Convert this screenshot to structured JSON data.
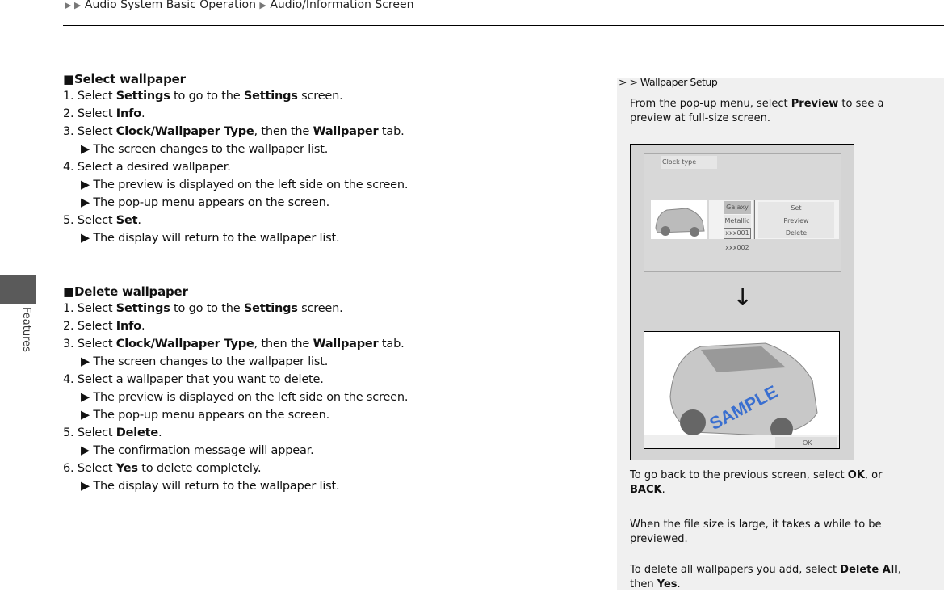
{
  "breadcrumb": {
    "items": [
      "Audio System Basic Operation",
      "Audio/Information Screen"
    ]
  },
  "side_tab": {
    "label": "Features"
  },
  "main": {
    "sections": [
      {
        "heading": "Select wallpaper",
        "lines": [
          [
            {
              "t": "1. Select "
            },
            {
              "t": "Settings",
              "b": true
            },
            {
              "t": " to go to the "
            },
            {
              "t": "Settings",
              "b": true
            },
            {
              "t": " screen."
            }
          ],
          [
            {
              "t": "2. Select "
            },
            {
              "t": "Info",
              "b": true
            },
            {
              "t": "."
            }
          ],
          [
            {
              "t": "3. Select "
            },
            {
              "t": "Clock/Wallpaper Type",
              "b": true
            },
            {
              "t": ", then the "
            },
            {
              "t": "Wallpaper",
              "b": true
            },
            {
              "t": " tab."
            }
          ],
          [
            {
              "t": "▶ The screen changes to the wallpaper list.",
              "i": true
            }
          ],
          [
            {
              "t": "4. Select a desired wallpaper."
            }
          ],
          [
            {
              "t": "▶ The preview is displayed on the left side on the screen.",
              "i": true
            }
          ],
          [
            {
              "t": "▶ The pop-up menu appears on the screen.",
              "i": true
            }
          ],
          [
            {
              "t": "5. Select "
            },
            {
              "t": "Set",
              "b": true
            },
            {
              "t": "."
            }
          ],
          [
            {
              "t": "▶ The display will return to the wallpaper list.",
              "i": true
            }
          ]
        ]
      },
      {
        "heading": "Delete wallpaper",
        "lines": [
          [
            {
              "t": "1. Select "
            },
            {
              "t": "Settings",
              "b": true
            },
            {
              "t": " to go to the "
            },
            {
              "t": "Settings",
              "b": true
            },
            {
              "t": " screen."
            }
          ],
          [
            {
              "t": "2. Select "
            },
            {
              "t": "Info",
              "b": true
            },
            {
              "t": "."
            }
          ],
          [
            {
              "t": "3. Select "
            },
            {
              "t": "Clock/Wallpaper Type",
              "b": true
            },
            {
              "t": ", then the "
            },
            {
              "t": "Wallpaper",
              "b": true
            },
            {
              "t": " tab."
            }
          ],
          [
            {
              "t": " ▶ The screen changes to the wallpaper list.",
              "i": true
            }
          ],
          [
            {
              "t": "4. Select a wallpaper that you want to delete."
            }
          ],
          [
            {
              "t": "▶ The preview is displayed on the left side on the screen.",
              "i": true
            }
          ],
          [
            {
              "t": "▶ The pop-up menu appears on the screen.",
              "i": true
            }
          ],
          [
            {
              "t": "5. Select "
            },
            {
              "t": "Delete",
              "b": true
            },
            {
              "t": "."
            }
          ],
          [
            {
              "t": "▶ The confirmation message will appear.",
              "i": true
            }
          ],
          [
            {
              "t": "6. Select "
            },
            {
              "t": "Yes",
              "b": true
            },
            {
              "t": " to delete completely."
            }
          ],
          [
            {
              "t": "▶ The display will return to the wallpaper list.",
              "i": true
            }
          ]
        ]
      }
    ]
  },
  "side_panel": {
    "header": "> > Wallpaper Setup",
    "notes": [
      [
        {
          "t": "From the pop-up menu, select "
        },
        {
          "t": "Preview",
          "b": true
        },
        {
          "t": " to see a preview at full-size screen."
        }
      ],
      [
        {
          "t": "To go back to the previous screen, select "
        },
        {
          "t": "OK",
          "b": true
        },
        {
          "t": ", or "
        },
        {
          "t": "BACK",
          "b": true
        },
        {
          "t": "."
        }
      ],
      [
        {
          "t": "When the file size is large, it takes a while to be previewed."
        }
      ],
      [
        {
          "t": "To delete all wallpapers you add, select "
        },
        {
          "t": "Delete All",
          "b": true
        },
        {
          "t": ", then "
        },
        {
          "t": "Yes",
          "b": true
        },
        {
          "t": "."
        }
      ]
    ],
    "screenshot": {
      "tab_label": "Clock type",
      "list": [
        "Galaxy",
        "Metallic",
        "xxx001",
        "xxx002"
      ],
      "menu": [
        "Set",
        "Preview",
        "Delete"
      ],
      "ok_label": "OK",
      "watermark": "SAMPLE"
    }
  }
}
